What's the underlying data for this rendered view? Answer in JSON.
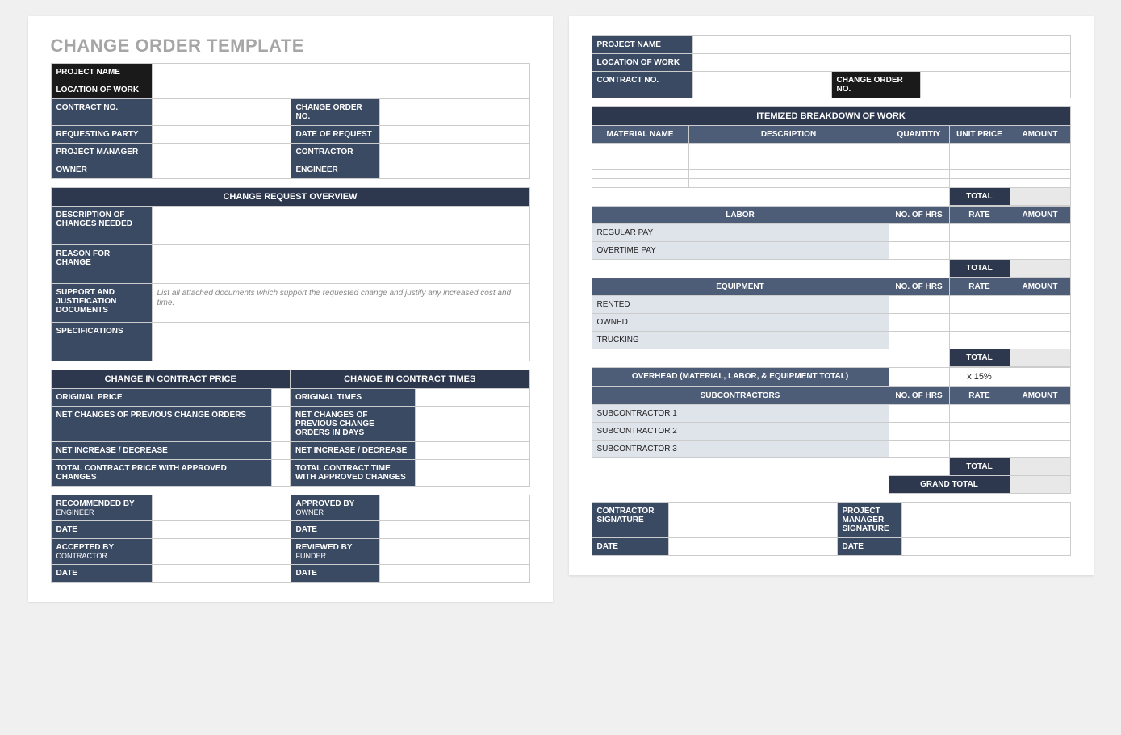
{
  "title": "CHANGE ORDER TEMPLATE",
  "p1": {
    "info": {
      "projectName": "PROJECT NAME",
      "locationOfWork": "LOCATION OF WORK",
      "contractNo": "CONTRACT NO.",
      "changeOrderNo": "CHANGE ORDER NO.",
      "requestingParty": "REQUESTING PARTY",
      "dateOfRequest": "DATE OF REQUEST",
      "projectManager": "PROJECT MANAGER",
      "contractor": "CONTRACTOR",
      "owner": "OWNER",
      "engineer": "ENGINEER"
    },
    "overview": {
      "header": "CHANGE REQUEST OVERVIEW",
      "descChanges": "DESCRIPTION OF CHANGES NEEDED",
      "reason": "REASON FOR CHANGE",
      "support": "SUPPORT AND JUSTIFICATION DOCUMENTS",
      "supportHint": "List all attached documents which support the requested change and justify any increased cost and time.",
      "specs": "SPECIFICATIONS"
    },
    "price": {
      "head": "CHANGE IN CONTRACT PRICE",
      "orig": "ORIGINAL PRICE",
      "netPrev": "NET CHANGES OF PREVIOUS CHANGE ORDERS",
      "netInc": "NET INCREASE / DECREASE",
      "total": "TOTAL CONTRACT PRICE WITH APPROVED CHANGES"
    },
    "times": {
      "head": "CHANGE IN CONTRACT TIMES",
      "orig": "ORIGINAL TIMES",
      "netPrev": "NET CHANGES OF PREVIOUS CHANGE ORDERS IN DAYS",
      "netInc": "NET INCREASE / DECREASE",
      "total": "TOTAL CONTRACT TIME WITH APPROVED CHANGES"
    },
    "sign": {
      "recommendedBy": "RECOMMENDED BY",
      "recommendedBySub": "ENGINEER",
      "approvedBy": "APPROVED BY",
      "approvedBySub": "OWNER",
      "acceptedBy": "ACCEPTED BY",
      "acceptedBySub": "CONTRACTOR",
      "reviewedBy": "REVIEWED BY",
      "reviewedBySub": "FUNDER",
      "date": "DATE"
    }
  },
  "p2": {
    "info": {
      "projectName": "PROJECT NAME",
      "locationOfWork": "LOCATION OF WORK",
      "contractNo": "CONTRACT NO.",
      "changeOrderNo": "CHANGE ORDER NO."
    },
    "breakdown": {
      "header": "ITEMIZED BREAKDOWN OF WORK",
      "materialName": "MATERIAL NAME",
      "description": "DESCRIPTION",
      "quantity": "QUANTITIY",
      "unitPrice": "UNIT PRICE",
      "amount": "AMOUNT",
      "total": "TOTAL"
    },
    "labor": {
      "head": "LABOR",
      "noHrs": "NO. OF HRS",
      "rate": "RATE",
      "amount": "AMOUNT",
      "regular": "REGULAR PAY",
      "overtime": "OVERTIME PAY",
      "total": "TOTAL"
    },
    "equip": {
      "head": "EQUIPMENT",
      "noHrs": "NO. OF HRS",
      "rate": "RATE",
      "amount": "AMOUNT",
      "rented": "RENTED",
      "owned": "OWNED",
      "trucking": "TRUCKING",
      "total": "TOTAL"
    },
    "overhead": {
      "label": "OVERHEAD (MATERIAL, LABOR, & EQUIPMENT TOTAL)",
      "pct": "x 15%"
    },
    "sub": {
      "head": "SUBCONTRACTORS",
      "noHrs": "NO. OF HRS",
      "rate": "RATE",
      "amount": "AMOUNT",
      "s1": "SUBCONTRACTOR 1",
      "s2": "SUBCONTRACTOR 2",
      "s3": "SUBCONTRACTOR 3",
      "total": "TOTAL",
      "grand": "GRAND TOTAL"
    },
    "sign": {
      "contractorSig": "CONTRACTOR SIGNATURE",
      "pmSig": "PROJECT MANAGER SIGNATURE",
      "date": "DATE"
    }
  }
}
